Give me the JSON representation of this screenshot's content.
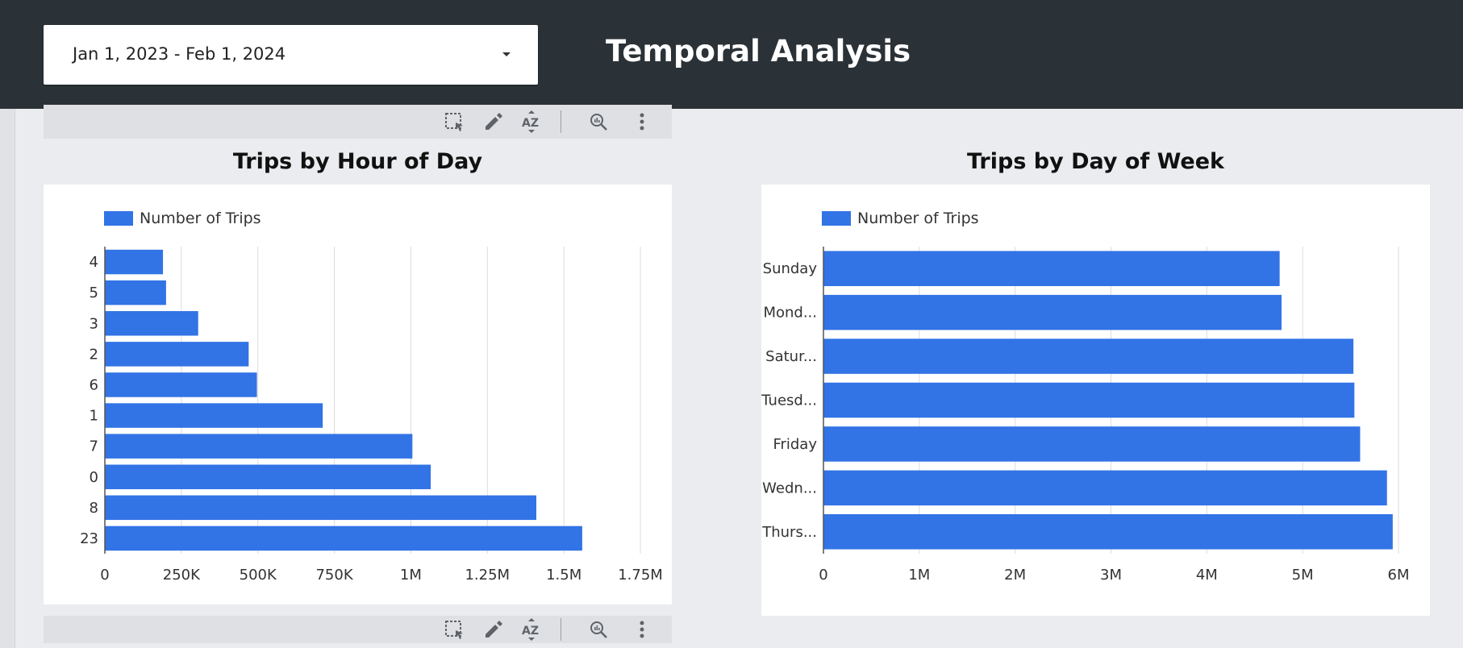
{
  "header": {
    "date_range": "Jan 1, 2023 - Feb 1, 2024",
    "title": "Temporal Analysis"
  },
  "toolbar_icons": [
    "select-area-icon",
    "edit-pencil-icon",
    "sort-az-icon",
    "explore-zoom-icon",
    "more-vert-icon"
  ],
  "colors": {
    "bar": "#3273e6",
    "header_bg": "#2b3237",
    "page_bg": "#eaecef"
  },
  "chart_data": [
    {
      "type": "bar",
      "orientation": "horizontal",
      "title": "Trips by Hour of Day",
      "legend": "top-left",
      "categories": [
        "4",
        "5",
        "3",
        "2",
        "6",
        "1",
        "7",
        "0",
        "8",
        "23"
      ],
      "series": [
        {
          "name": "Number of Trips",
          "values": [
            190000,
            200000,
            305000,
            470000,
            497000,
            712000,
            1005000,
            1065000,
            1410000,
            1560000
          ]
        }
      ],
      "x_ticks": [
        "0",
        "250K",
        "500K",
        "750K",
        "1M",
        "1.25M",
        "1.5M",
        "1.75M"
      ],
      "xlim": [
        0,
        1750000
      ],
      "grid": true
    },
    {
      "type": "bar",
      "orientation": "horizontal",
      "title": "Trips by Day of Week",
      "legend": "top-left",
      "categories": [
        "Sunday",
        "Mond...",
        "Satur...",
        "Tuesd...",
        "Friday",
        "Wedn...",
        "Thurs..."
      ],
      "series": [
        {
          "name": "Number of Trips",
          "values": [
            4760000,
            4780000,
            5530000,
            5540000,
            5600000,
            5880000,
            5940000
          ]
        }
      ],
      "x_ticks": [
        "0",
        "1M",
        "2M",
        "3M",
        "4M",
        "5M",
        "6M"
      ],
      "xlim": [
        0,
        6000000
      ],
      "grid": true
    }
  ]
}
